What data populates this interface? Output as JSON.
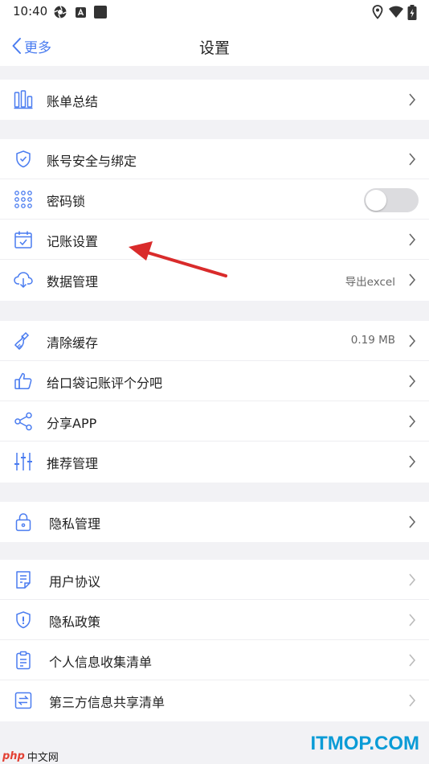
{
  "status_bar": {
    "time": "10:40"
  },
  "nav": {
    "back_label": "更多",
    "title": "设置"
  },
  "groups": [
    {
      "items": [
        {
          "label": "账单总结",
          "icon": "bar-chart-icon"
        }
      ]
    },
    {
      "items": [
        {
          "label": "账号安全与绑定",
          "icon": "shield-check-icon"
        },
        {
          "label": "密码锁",
          "icon": "keypad-icon",
          "toggle": false
        },
        {
          "label": "记账设置",
          "icon": "calendar-check-icon"
        },
        {
          "label": "数据管理",
          "icon": "cloud-download-icon",
          "value": "导出excel"
        }
      ]
    },
    {
      "items": [
        {
          "label": "清除缓存",
          "icon": "broom-icon",
          "value": "0.19 MB"
        },
        {
          "label": "给口袋记账评个分吧",
          "icon": "thumbs-up-icon"
        },
        {
          "label": "分享APP",
          "icon": "share-icon"
        },
        {
          "label": "推荐管理",
          "icon": "sliders-icon"
        }
      ]
    },
    {
      "items": [
        {
          "label": "隐私管理",
          "icon": "lock-icon"
        }
      ]
    },
    {
      "items": [
        {
          "label": "用户协议",
          "icon": "document-icon"
        },
        {
          "label": "隐私政策",
          "icon": "shield-info-icon"
        },
        {
          "label": "个人信息收集清单",
          "icon": "clipboard-icon"
        },
        {
          "label": "第三方信息共享清单",
          "icon": "exchange-icon"
        }
      ]
    }
  ],
  "watermarks": {
    "itmop": "ITMOP.COM",
    "php": "php",
    "php_cn": "中文网"
  },
  "colors": {
    "accent": "#4a7cf0",
    "annotation_arrow": "#d92b2b"
  }
}
